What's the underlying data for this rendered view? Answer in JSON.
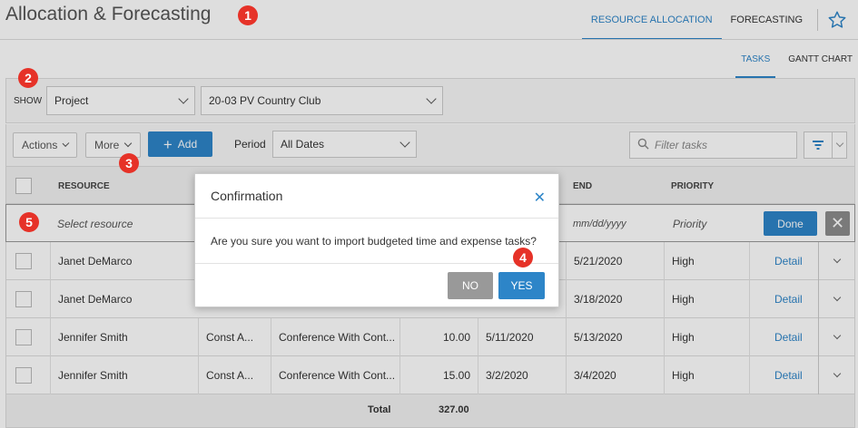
{
  "header": {
    "title": "Allocation & Forecasting",
    "tabs": [
      {
        "label": "RESOURCE ALLOCATION",
        "active": true
      },
      {
        "label": "FORECASTING",
        "active": false
      }
    ],
    "favorite_icon": "star-icon"
  },
  "subnav": {
    "tabs": [
      {
        "label": "TASKS",
        "active": true
      },
      {
        "label": "GANTT CHART",
        "active": false
      }
    ]
  },
  "filters": {
    "show_label": "SHOW",
    "show_value": "Project",
    "project_value": "20-03 PV Country Club"
  },
  "toolbar": {
    "actions_label": "Actions",
    "more_label": "More",
    "add_label": "Add",
    "period_label": "Period",
    "period_value": "All Dates",
    "search_placeholder": "Filter tasks"
  },
  "table": {
    "columns": {
      "resource": "RESOURCE",
      "end": "END",
      "priority": "PRIORITY"
    },
    "edit_row": {
      "resource_placeholder": "Select resource",
      "end_placeholder": "mm/dd/yyyy",
      "priority_placeholder": "Priority",
      "done_label": "Done"
    },
    "rows": [
      {
        "resource": "Janet DeMarco",
        "category": "",
        "task": "",
        "hours": "",
        "start": "",
        "end": "5/21/2020",
        "priority": "High",
        "action": "Detail"
      },
      {
        "resource": "Janet DeMarco",
        "category": "",
        "task": "",
        "hours": "",
        "start": "",
        "end": "3/18/2020",
        "priority": "High",
        "action": "Detail"
      },
      {
        "resource": "Jennifer Smith",
        "category": "Const A...",
        "task": "Conference With Cont...",
        "hours": "10.00",
        "start": "5/11/2020",
        "end": "5/13/2020",
        "priority": "High",
        "action": "Detail"
      },
      {
        "resource": "Jennifer Smith",
        "category": "Const A...",
        "task": "Conference With Cont...",
        "hours": "15.00",
        "start": "3/2/2020",
        "end": "3/4/2020",
        "priority": "High",
        "action": "Detail"
      }
    ],
    "total": {
      "label": "Total",
      "value": "327.00"
    }
  },
  "modal": {
    "title": "Confirmation",
    "message": "Are you sure you want to import budgeted time and expense tasks?",
    "no_label": "NO",
    "yes_label": "YES"
  },
  "callouts": [
    "1",
    "2",
    "3",
    "4",
    "5"
  ],
  "colors": {
    "accent": "#2d85c8",
    "callout": "#e63228",
    "no_button": "#999999"
  }
}
